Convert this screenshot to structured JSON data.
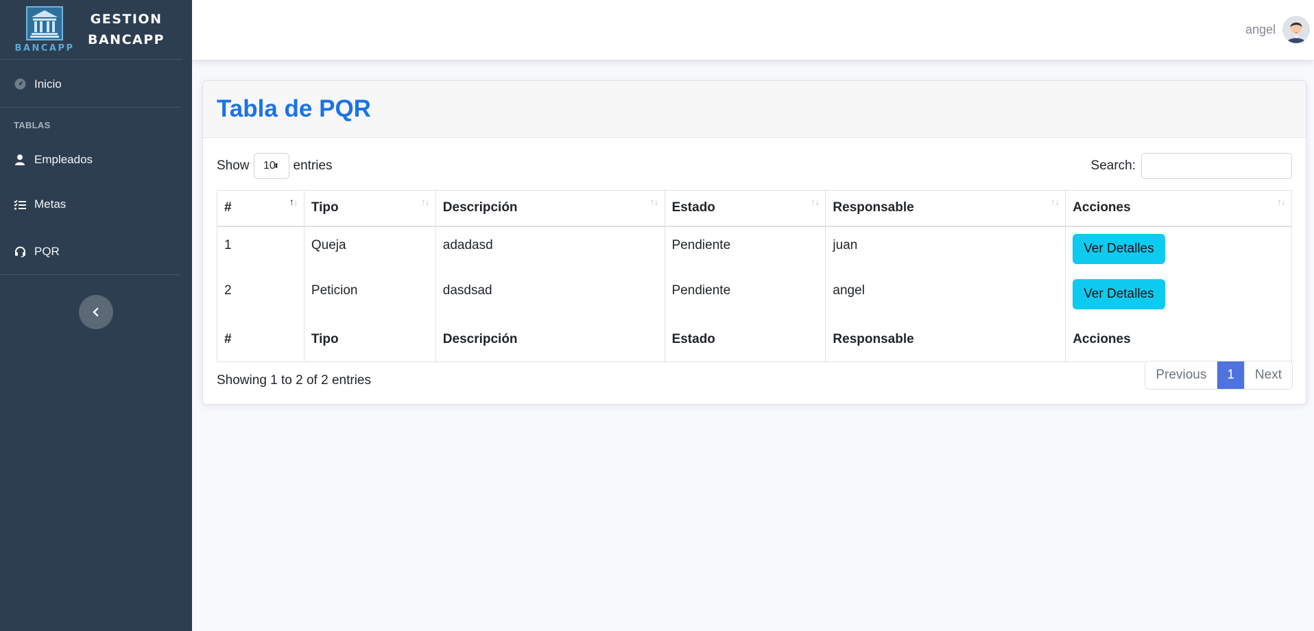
{
  "brand": {
    "logo_text": "BANCAPP",
    "name_line1": "GESTION",
    "name_line2": "BANCAPP"
  },
  "sidebar": {
    "inicio": "Inicio",
    "heading": "TABLAS",
    "items": [
      {
        "label": "Empleados",
        "icon": "user-icon"
      },
      {
        "label": "Metas",
        "icon": "list-check-icon"
      },
      {
        "label": "PQR",
        "icon": "headset-icon"
      }
    ],
    "collapse_icon": "chevron-left-icon"
  },
  "topbar": {
    "user_name": "angel"
  },
  "card": {
    "title": "Tabla de PQR"
  },
  "datatable": {
    "show_label": "Show",
    "entries_label": "entries",
    "page_length": "10",
    "search_label": "Search:",
    "search_value": "",
    "columns": [
      "#",
      "Tipo",
      "Descripción",
      "Estado",
      "Responsable",
      "Acciones"
    ],
    "rows": [
      {
        "id": "1",
        "tipo": "Queja",
        "descripcion": "adadasd",
        "estado": "Pendiente",
        "responsable": "juan",
        "action": "Ver Detalles"
      },
      {
        "id": "2",
        "tipo": "Peticion",
        "descripcion": "dasdsad",
        "estado": "Pendiente",
        "responsable": "angel",
        "action": "Ver Detalles"
      }
    ],
    "info": "Showing 1 to 2 of 2 entries",
    "pagination": {
      "previous": "Previous",
      "current": "1",
      "next": "Next"
    }
  },
  "colors": {
    "sidebar_bg": "#2d3e50",
    "title": "#1a73e8",
    "info_button": "#0dcaf0",
    "page_active": "#4e73df"
  }
}
